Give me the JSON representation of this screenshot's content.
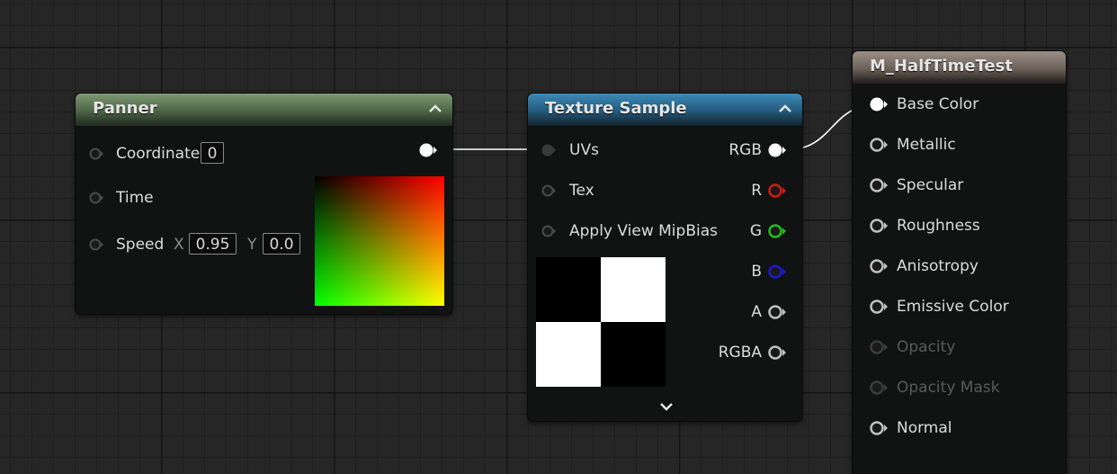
{
  "panner": {
    "title": "Panner",
    "coordinate_label": "Coordinate",
    "coordinate_value": "0",
    "time_label": "Time",
    "speed_label": "Speed",
    "speed_x_axis": "X",
    "speed_x_value": "0.95",
    "speed_y_axis": "Y",
    "speed_y_value": "0.0"
  },
  "texture_sample": {
    "title": "Texture Sample",
    "inputs": {
      "uvs": "UVs",
      "tex": "Tex",
      "mipbias": "Apply View MipBias"
    },
    "outputs": {
      "rgb": "RGB",
      "r": "R",
      "g": "G",
      "b": "B",
      "a": "A",
      "rgba": "RGBA"
    }
  },
  "material": {
    "title": "M_HalfTimeTest",
    "pins": {
      "base_color": "Base Color",
      "metallic": "Metallic",
      "specular": "Specular",
      "roughness": "Roughness",
      "anisotropy": "Anisotropy",
      "emissive_color": "Emissive Color",
      "opacity": "Opacity",
      "opacity_mask": "Opacity Mask",
      "normal": "Normal"
    }
  },
  "colors": {
    "panner_header": "#5f7a58",
    "texture_header": "#2f7096",
    "material_header": "#726860",
    "pin_r": "#d01a1a",
    "pin_g": "#1fbf1f",
    "pin_b": "#1a1ad0"
  }
}
